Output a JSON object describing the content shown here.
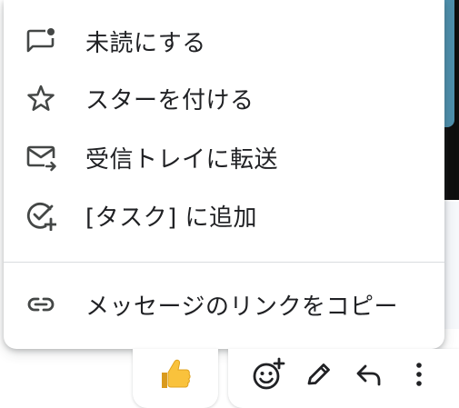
{
  "menu": {
    "items": [
      {
        "label": "未読にする",
        "icon": "mark-unread-icon"
      },
      {
        "label": "スターを付ける",
        "icon": "star-icon"
      },
      {
        "label": "受信トレイに転送",
        "icon": "forward-to-inbox-icon"
      },
      {
        "label": "[タスク] に追加",
        "icon": "add-task-icon"
      },
      {
        "label": "メッセージのリンクをコピー",
        "icon": "link-icon"
      }
    ]
  },
  "reactions": {
    "thumbs_up": "👍"
  },
  "toolbar": {
    "icons": [
      "add-reaction-icon",
      "edit-icon",
      "reply-icon",
      "more-vert-icon"
    ]
  },
  "colors": {
    "icon": "#444746",
    "text": "#202124",
    "divider": "#dadce0",
    "thumb": "#f9c23c"
  }
}
